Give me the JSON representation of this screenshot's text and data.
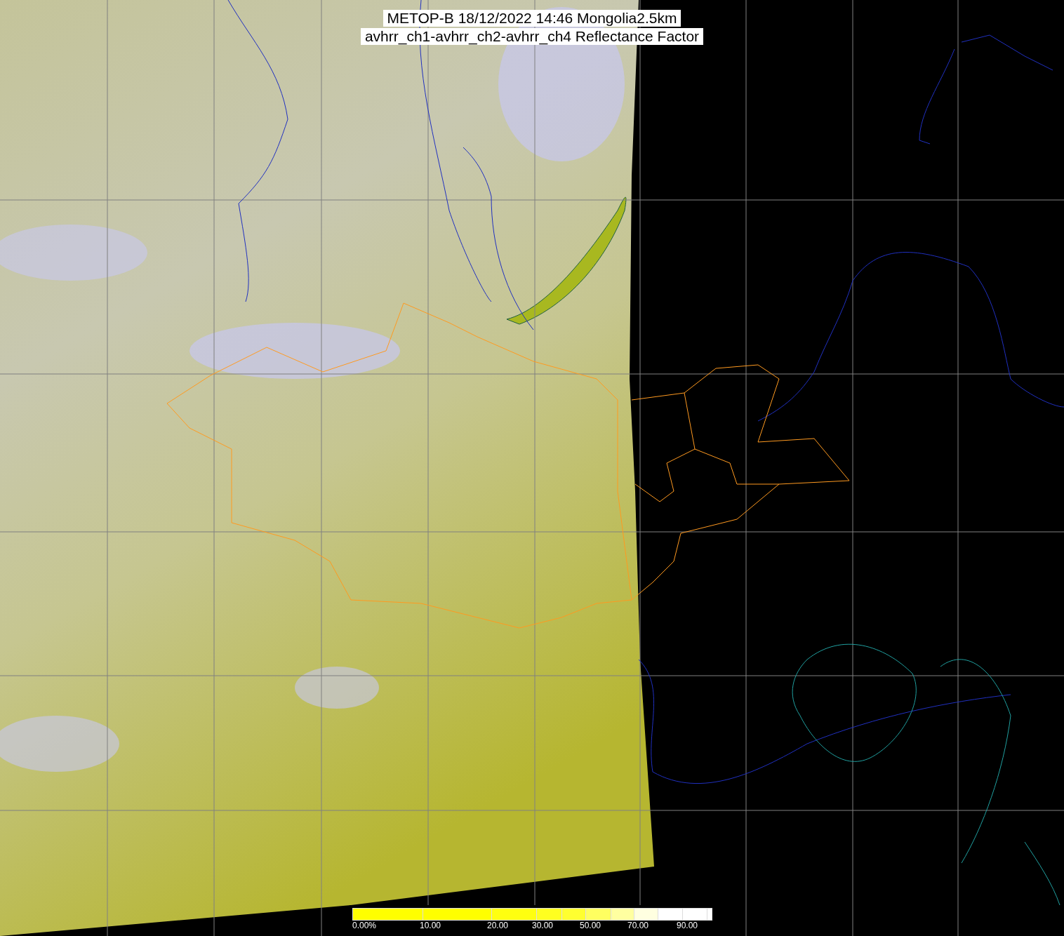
{
  "title": {
    "lines": [
      "METOP-B 18/12/2022 14:46 Mongolia2.5km",
      "avhrr_ch1-avhrr_ch2-avhrr_ch4 Reflectance Factor"
    ]
  },
  "colorbar": {
    "ticks": [
      "0.00%",
      "10.00",
      "20.00",
      "30.00",
      "50.00",
      "70.00",
      "90.00"
    ]
  }
}
